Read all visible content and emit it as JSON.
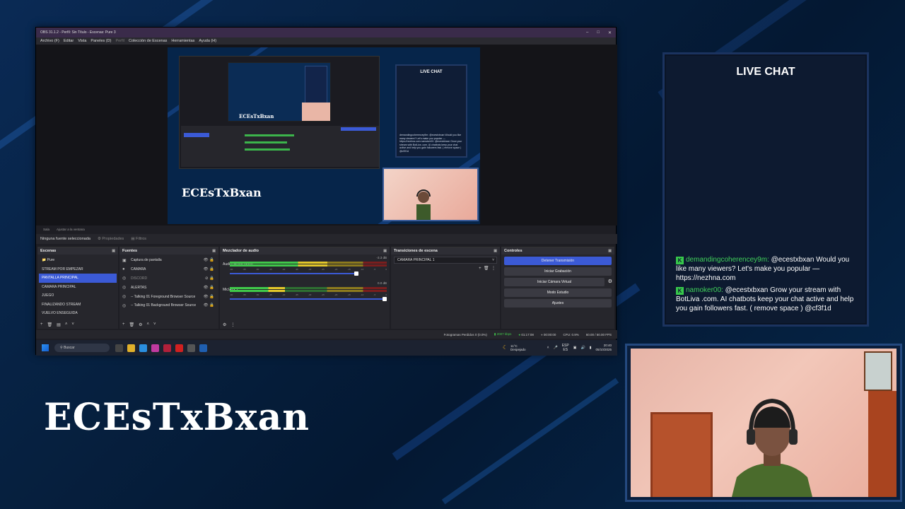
{
  "obs": {
    "title": "OBS 31.1.2 - Perfil: Sin Título - Escenas: Pure 3",
    "menu": [
      "Archivo (F)",
      "Editar",
      "Vista",
      "Paneles (D)",
      "Perfil",
      "Colección de Escenas",
      "Herramientas",
      "Ayuda (H)"
    ],
    "subbar": [
      "Sala",
      "Ajustar a la ventana"
    ],
    "no_source": "Ninguna fuente seleccionada",
    "properties": "Propiedades",
    "filters": "Filtros",
    "preview": {
      "brand": "ECEsTxBxan",
      "nested_brand": "ECEsTxBxan",
      "chat_title": "LIVE CHAT",
      "chat_msg": "demandingcoherencey9m: @ecestxbxan Would you like many viewers? Let's make you popular — https://nezhna.com namoker00: @ecestxbxan Grow your stream with BotLiva .com. AI chatbots keep your chat active and help you gain followers fast. ( remove space ) @cf3f1d"
    },
    "scenes": {
      "title": "Escenas",
      "items": [
        "Pure",
        "STREAM POR EMPEZAR",
        "PANTALLA PRINCIPAL",
        "CAMARA PRINCIPAL",
        "JUEGO",
        "FINALIZANDO STREAM",
        "VUELVO ENSEGUIDA"
      ],
      "selected_index": 2
    },
    "sources": {
      "title": "Fuentes",
      "items": [
        {
          "label": "Captura de pantalla",
          "icon": "monitor-icon"
        },
        {
          "label": "CAMARA",
          "icon": "camera-icon"
        },
        {
          "label": "DISCORD",
          "icon": "globe-icon",
          "hidden": true
        },
        {
          "label": "ALERTAS",
          "icon": "globe-icon"
        },
        {
          "label": "-- Talking 01  Foreground Browser Source",
          "icon": "globe-icon"
        },
        {
          "label": "-- Talking 01  Background Browser Source",
          "icon": "globe-icon"
        }
      ]
    },
    "mixer": {
      "title": "Mezclador de audio",
      "channels": [
        {
          "name": "Audio del escritorio",
          "db": "-3.3 dB",
          "level": 0.62
        },
        {
          "name": "Mic/Aux 2",
          "db": "0.0 dB",
          "level": 0.35
        }
      ],
      "scale": [
        "-60",
        "-55",
        "-50",
        "-45",
        "-40",
        "-35",
        "-30",
        "-25",
        "-20",
        "-15",
        "-10",
        "-5",
        "0"
      ]
    },
    "transitions": {
      "title": "Transiciones de escena",
      "selected": "CAMARA PRINCIPAL 1"
    },
    "controls": {
      "title": "Controles",
      "buttons": [
        "Detener Transmisión",
        "Iniciar Grabación",
        "Iniciar Cámara Virtual",
        "Modo Estudio",
        "Ajustes"
      ]
    },
    "status": {
      "dropped": "Fotogramas Perdidos 0 (0.0%)",
      "bitrate": "2007 kbps",
      "live_time": "01:17:08",
      "rec_time": "00:00:00",
      "cpu": "CPU: 0.9%",
      "fps": "60.00 / 60.00 FPS"
    },
    "taskbar": {
      "search": "Buscar",
      "weather_temp": "11°C",
      "weather_desc": "Despejado",
      "lang": "ESP",
      "lang_sub": "ES",
      "time": "20:40",
      "date": "05/10/2025"
    }
  },
  "chat": {
    "title": "LIVE CHAT",
    "messages": [
      {
        "user": "demandingcoherencey9m:",
        "text": " @ecestxbxan Would you like many viewers? Let's make you popular — https://nezhna.com"
      },
      {
        "user": "namoker00:",
        "text": " @ecestxbxan Grow your stream with BotLiva .com. AI chatbots keep your chat active and help you gain followers fast. ( remove space ) @cf3f1d"
      }
    ]
  },
  "brand": "ECEsTxBxan",
  "colors": {
    "accent": "#3b5ad6",
    "chat_user": "#40d05a",
    "background": "#06203f"
  }
}
